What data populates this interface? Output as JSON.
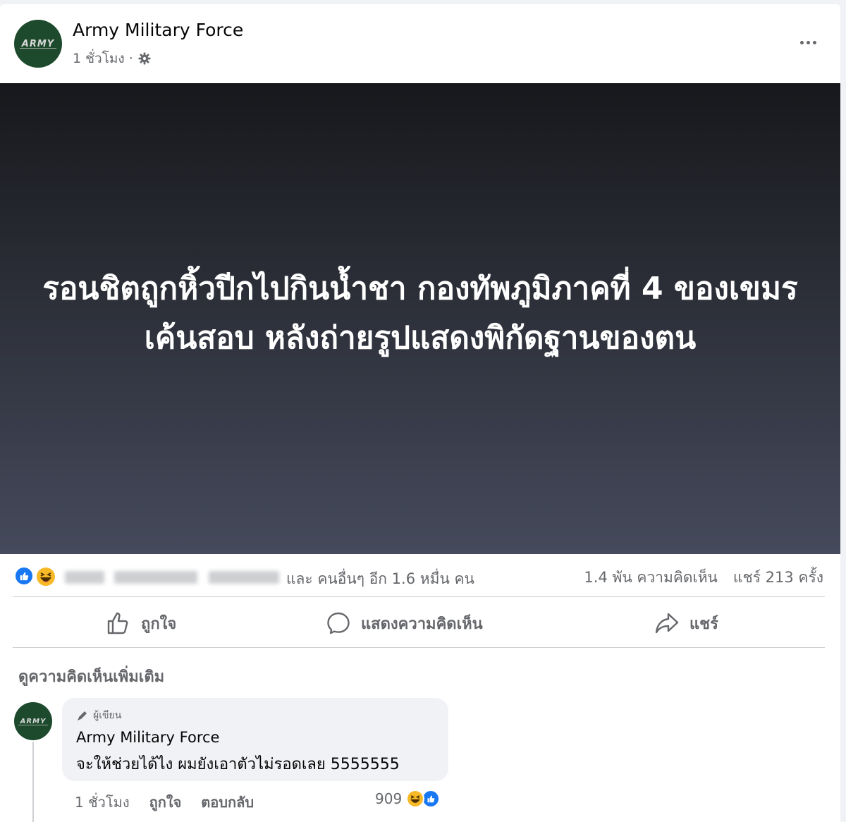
{
  "post": {
    "page_name": "Army Military Force",
    "avatar_text": "ARMY",
    "time": "1 ชั่วโมง",
    "separator": "·",
    "privacy_icon": "gear-icon",
    "more_icon": "more-dots-icon"
  },
  "hero": {
    "text": "รอนชิตถูกหิ้วปีกไปกินน้ำชา กองทัพภูมิภาคที่ 4 ของเขมรเค้นสอบ หลังถ่ายรูปแสดงพิกัดฐานของตน",
    "gradient_top": "#17181c",
    "gradient_bottom": "#454a5c"
  },
  "reactions": {
    "icons": [
      "like-reaction-icon",
      "haha-reaction-icon"
    ],
    "others_text": "และ คนอื่นๆ อีก 1.6 หมื่น คน",
    "comments_count": "1.4 พัน ความคิดเห็น",
    "shares_count": "แชร์ 213 ครั้ง"
  },
  "actions": {
    "like_label": "ถูกใจ",
    "comment_label": "แสดงความคิดเห็น",
    "share_label": "แชร์"
  },
  "comments": {
    "view_more_label": "ดูความคิดเห็นเพิ่มเติม",
    "items": [
      {
        "badge": "ผู้เขียน",
        "author": "Army Military Force",
        "text": "จะให้ช่วยได้ไง ผมยังเอาตัวไม่รอดเลย 5555555",
        "time": "1 ชั่วโมง",
        "like_label": "ถูกใจ",
        "reply_label": "ตอบกลับ",
        "reaction_count": "909"
      }
    ]
  },
  "colors": {
    "accent": "#1877f2",
    "haha": "#f7b928",
    "secondary_text": "#65676b",
    "avatar_bg": "#1d4a2c"
  }
}
